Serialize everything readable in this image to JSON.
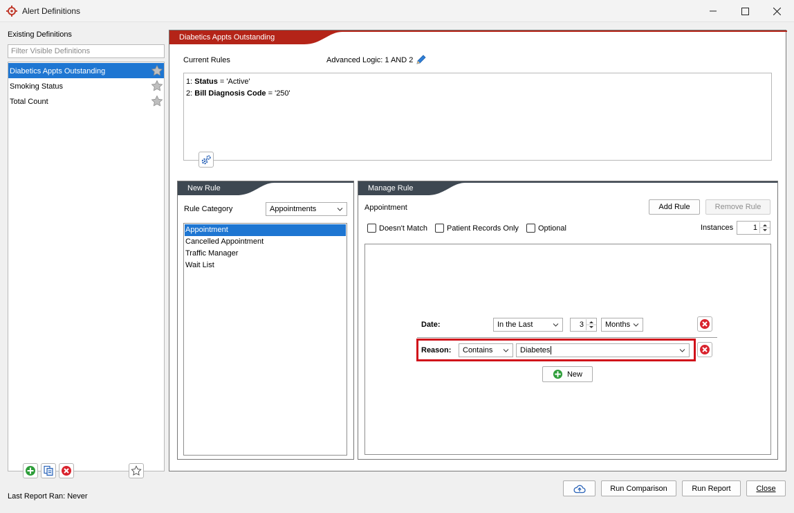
{
  "window": {
    "title": "Alert Definitions"
  },
  "left": {
    "heading": "Existing Definitions",
    "filter_placeholder": "Filter Visible Definitions",
    "definitions": [
      {
        "label": "Diabetics Appts Outstanding",
        "selected": true
      },
      {
        "label": "Smoking Status",
        "selected": false
      },
      {
        "label": "Total Count",
        "selected": false
      }
    ],
    "last_report": "Last Report Ran: Never"
  },
  "main": {
    "tab_title": "Diabetics Appts Outstanding",
    "current_rules_label": "Current Rules",
    "advanced_logic": "Advanced Logic: 1 AND 2",
    "rules": [
      {
        "num": "1:",
        "field": "Status",
        "op": " = ",
        "value": "'Active'"
      },
      {
        "num": "2:",
        "field": "Bill Diagnosis Code",
        "op": " = ",
        "value": "'250'"
      }
    ]
  },
  "new_rule": {
    "tab_title": "New Rule",
    "category_label": "Rule Category",
    "category_value": "Appointments",
    "items": [
      {
        "label": "Appointment",
        "selected": true
      },
      {
        "label": "Cancelled Appointment",
        "selected": false
      },
      {
        "label": "Traffic Manager",
        "selected": false
      },
      {
        "label": "Wait List",
        "selected": false
      }
    ]
  },
  "manage_rule": {
    "tab_title": "Manage Rule",
    "rule_name": "Appointment",
    "add_rule": "Add Rule",
    "remove_rule": "Remove Rule",
    "doesnt_match": "Doesn't Match",
    "patient_records_only": "Patient Records Only",
    "optional": "Optional",
    "instances_label": "Instances",
    "instances_value": "1",
    "date": {
      "label": "Date:",
      "op": "In the Last",
      "amount": "3",
      "unit": "Months"
    },
    "reason": {
      "label": "Reason:",
      "op": "Contains",
      "value": "Diabetes"
    },
    "new_label": "New"
  },
  "footer": {
    "run_comparison": "Run Comparison",
    "run_report": "Run Report",
    "close": "Close"
  },
  "colors": {
    "accent_red": "#b42418",
    "tab_dark": "#3e4852",
    "selection_blue": "#1e76d2",
    "highlight_red": "#d0101a"
  }
}
